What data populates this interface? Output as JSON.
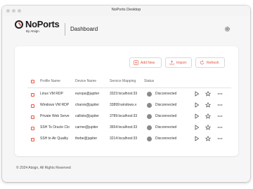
{
  "window": {
    "title": "NoPorts Desktop"
  },
  "brand": {
    "name": "NoPorts",
    "sub": "By Atsign"
  },
  "header": {
    "title": "Dashboard"
  },
  "toolbar": {
    "add_label": "Add New",
    "import_label": "Import",
    "refresh_label": "Refresh"
  },
  "table": {
    "columns": [
      "Profile Name",
      "Device Name",
      "Service Mapping",
      "Status"
    ],
    "rows": [
      {
        "profile": "Linux VM RDP",
        "device": "europa@jupiter",
        "mapping": "3323:localhost:33",
        "status": "Disconnected"
      },
      {
        "profile": "Windows VM RDP",
        "device": "charon@jupiter",
        "mapping": "33899:windows.v",
        "status": "Disconnected"
      },
      {
        "profile": "Private Web Serve",
        "device": "callisto@jupiter",
        "mapping": "3789:localhost:33",
        "status": "Disconnected"
      },
      {
        "profile": "SSH To Oracle Clo",
        "device": "carme@jupiter",
        "mapping": "3654:localhost:33",
        "status": "Disconnected"
      },
      {
        "profile": "SSH to Air Quality",
        "device": "thebe@jupiter",
        "mapping": "3214:localhost:33",
        "status": "Disconnected"
      }
    ]
  },
  "footer": {
    "text": "© 2024 Atsign, All Rights Reserved"
  },
  "colors": {
    "accent": "#e8533f",
    "status_gray": "#8a8a8a"
  }
}
